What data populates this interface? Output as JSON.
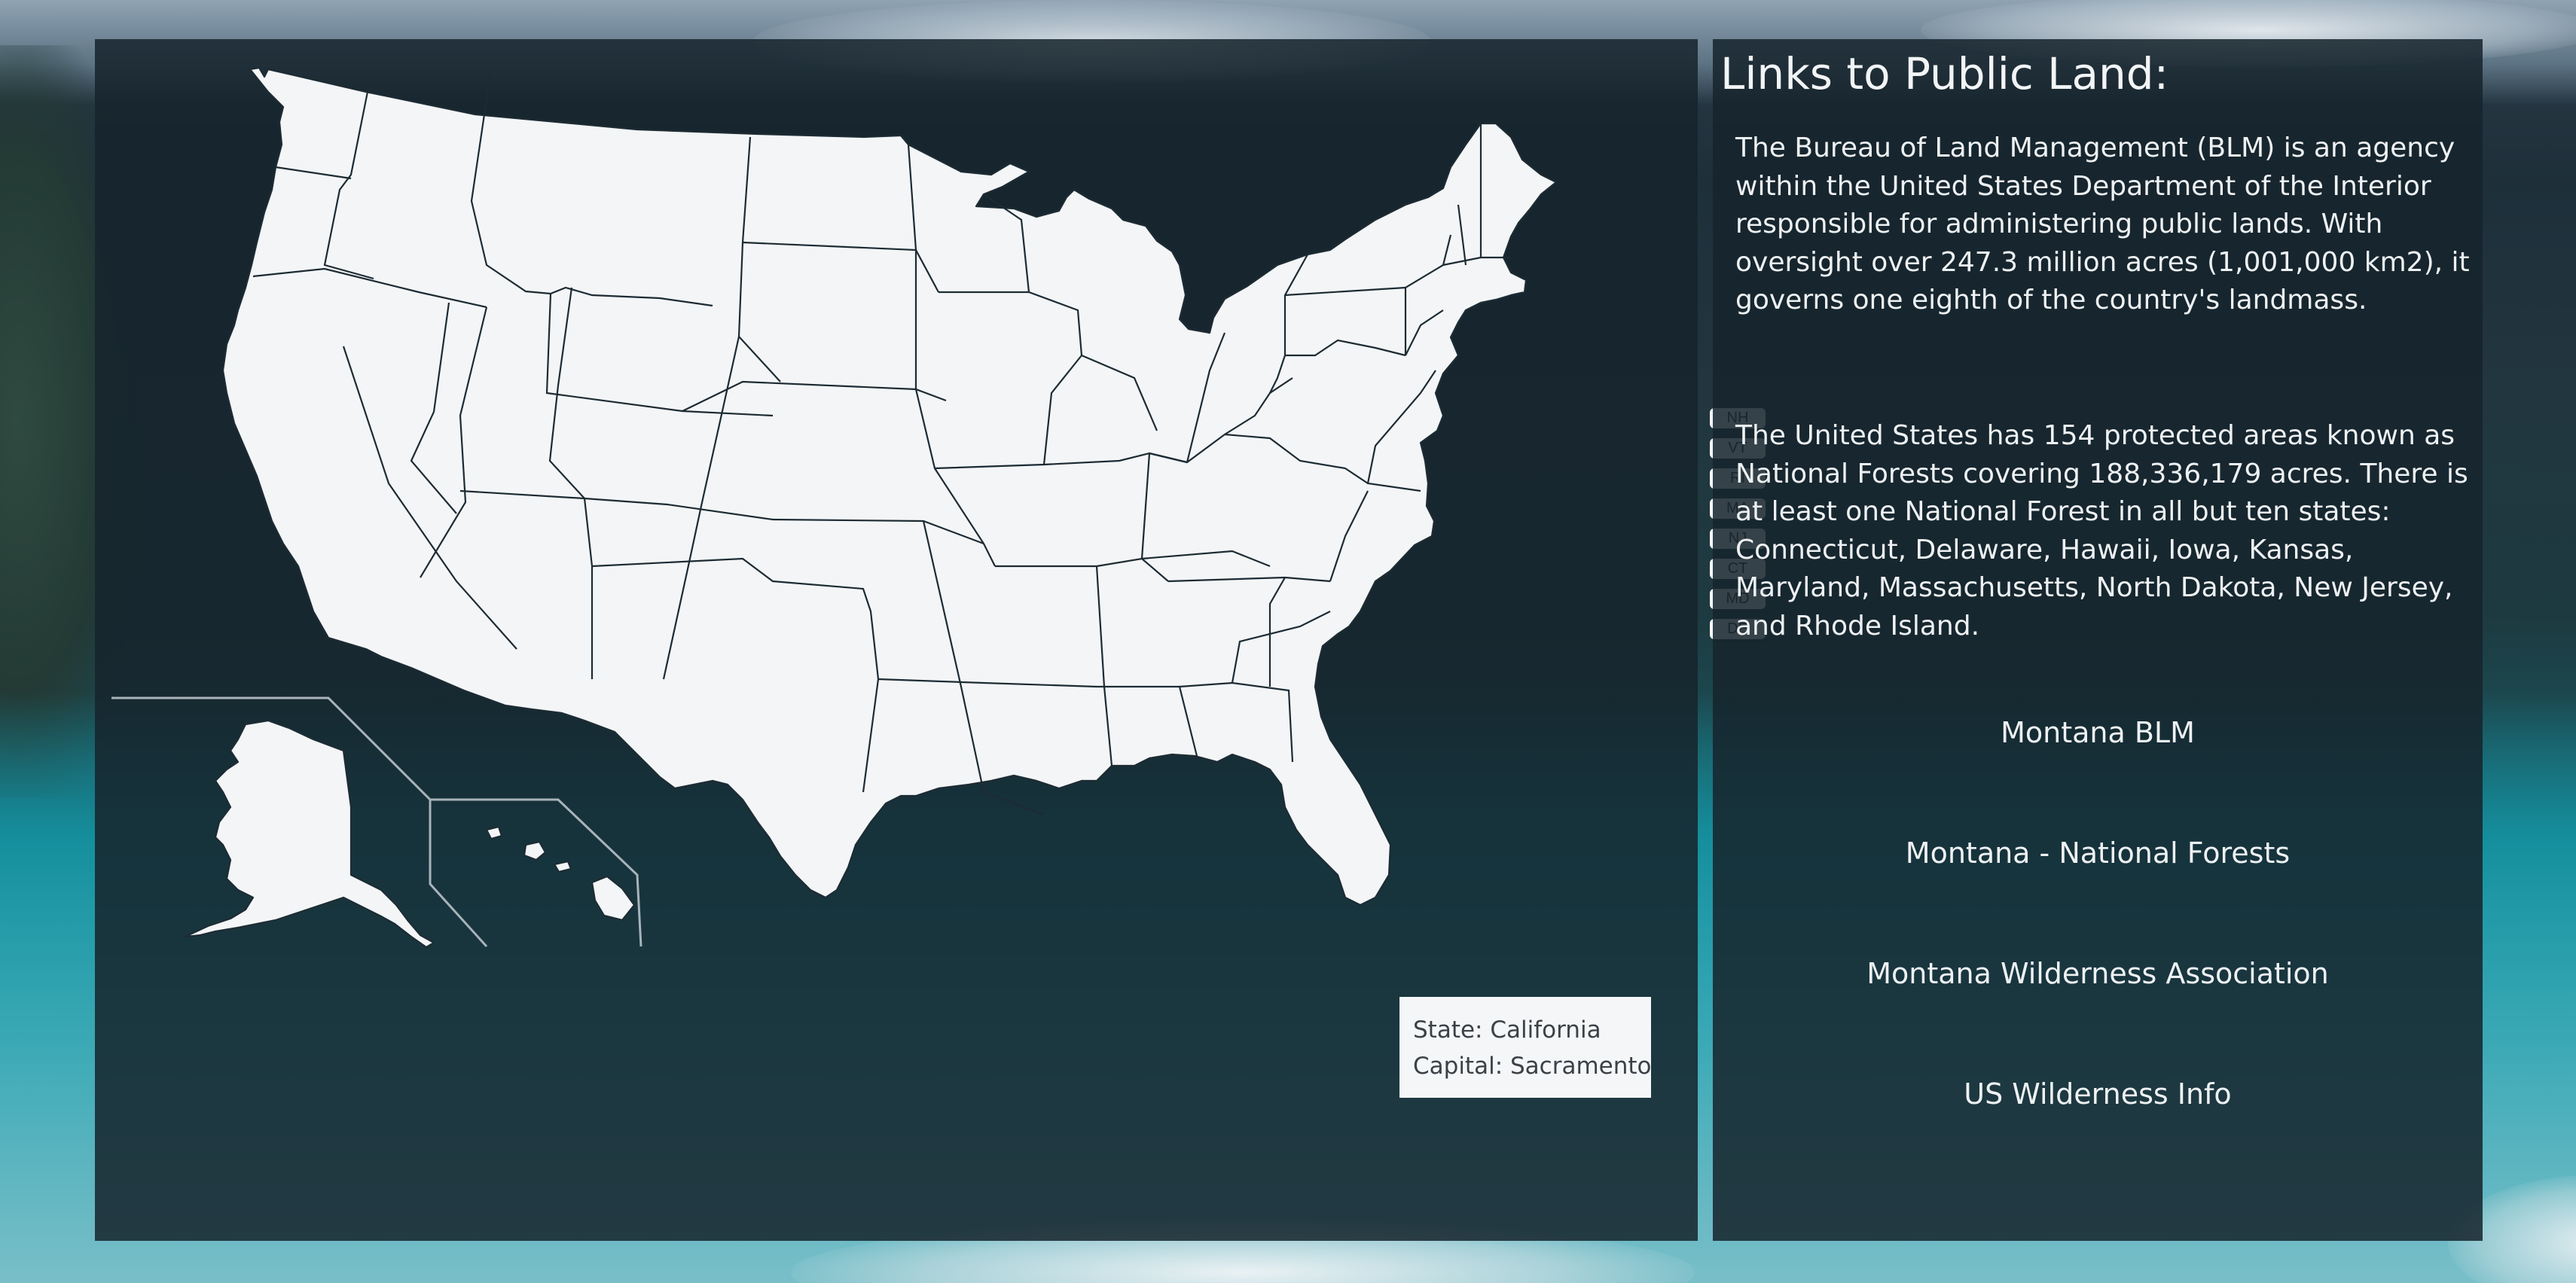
{
  "map": {
    "state_tags": [
      "NH",
      "VT",
      "RI",
      "MA",
      "NJ",
      "CT",
      "MD",
      "DE"
    ],
    "tooltip": {
      "state_line": "State: California",
      "capital_line": "Capital: Sacramento"
    },
    "colors": {
      "state_fill": "#f3f5f7",
      "state_border": "#1d2b33",
      "panel": "#16242c"
    }
  },
  "links_panel": {
    "title": "Links to Public Land:",
    "paragraphs": [
      "The Bureau of Land Management (BLM) is an agency within the United States Department of the Interior responsible for administering public lands. With oversight over 247.3 million acres (1,001,000 km2), it governs one eighth of the country's landmass.",
      "The United States has 154 protected areas known as National Forests covering 188,336,179 acres. There is at least one National Forest in all but ten states: Connecticut, Delaware, Hawaii, Iowa, Kansas, Maryland, Massachusetts, North Dakota, New Jersey, and Rhode Island."
    ],
    "links": [
      "Montana BLM",
      "Montana - National Forests",
      "Montana Wilderness Association",
      "US Wilderness Info"
    ]
  }
}
